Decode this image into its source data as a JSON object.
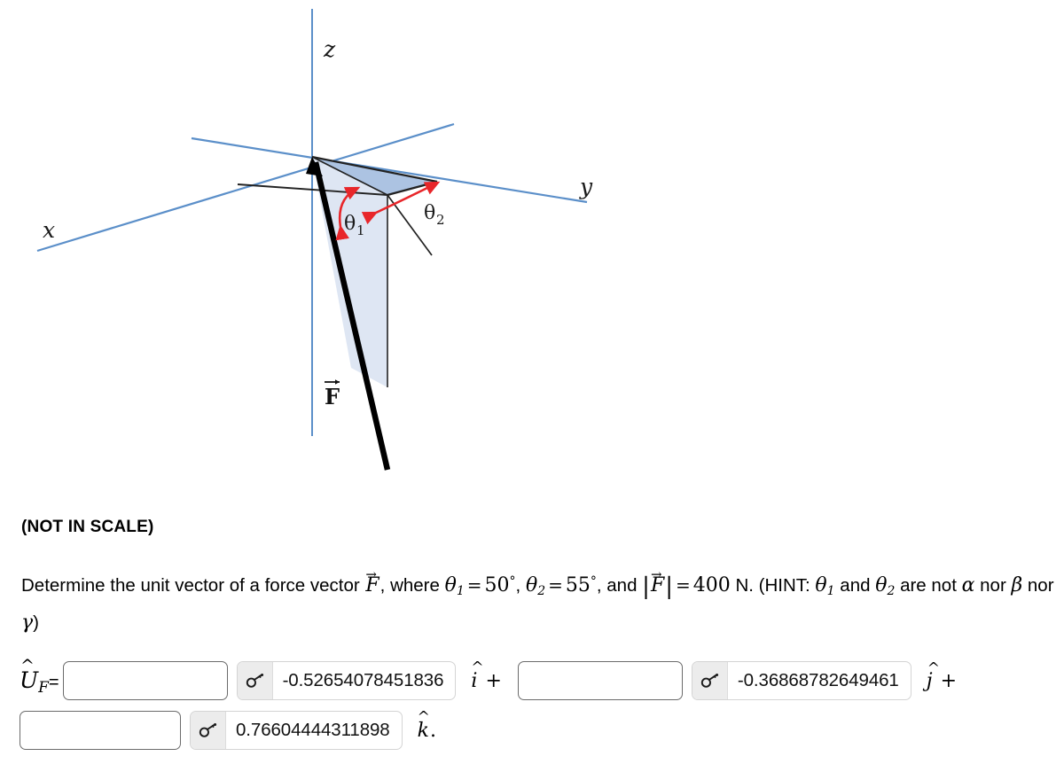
{
  "figure": {
    "caption": "(NOT IN SCALE)",
    "axis_labels": {
      "x": "x",
      "y": "y",
      "z": "z"
    },
    "angle_labels": {
      "theta1_base": "θ",
      "theta1_sub": "1",
      "theta2_base": "θ",
      "theta2_sub": "2"
    },
    "vector_label": "F",
    "colors": {
      "axis": "#5b8fc9",
      "angle_arc": "#e8262a",
      "plane_fill_dark": "#a8c0e0",
      "plane_fill_light": "#dce5f2",
      "vector": "#000000"
    }
  },
  "problem": {
    "prefix": "Determine the unit vector of a force vector ",
    "vecF": "F",
    "after_vecF": ", where ",
    "theta": "θ",
    "theta1_sub": "1",
    "eq": "=",
    "theta1_value": "50",
    "degree": "°",
    "comma1": ", ",
    "theta2_sub": "2",
    "theta2_value": "55",
    "comma2": ", and ",
    "magnitude_value": "400",
    "unit": "N.",
    "hint_open": "(HINT: ",
    "hint_line2_start": "and ",
    "hint_line2_mid": " are not ",
    "alpha": "α",
    "nor1": " nor ",
    "beta": "β",
    "nor2": " nor ",
    "gamma": "γ",
    "hint_close": ")"
  },
  "answer": {
    "label_U": "U",
    "label_sub": "F",
    "label_eq": "=",
    "rows": [
      {
        "blank_value": "",
        "blank_placeholder": "",
        "key_icon": "key-icon",
        "computed_value": "-0.52654078451836",
        "component": "i",
        "trailing": "+"
      },
      {
        "blank_value": "",
        "blank_placeholder": "",
        "key_icon": "key-icon",
        "computed_value": "-0.36868782649461",
        "component": "j",
        "trailing": "+"
      },
      {
        "blank_value": "",
        "blank_placeholder": "",
        "key_icon": "key-icon",
        "computed_value": "0.76604444311898",
        "component": "k",
        "trailing": "."
      }
    ]
  }
}
